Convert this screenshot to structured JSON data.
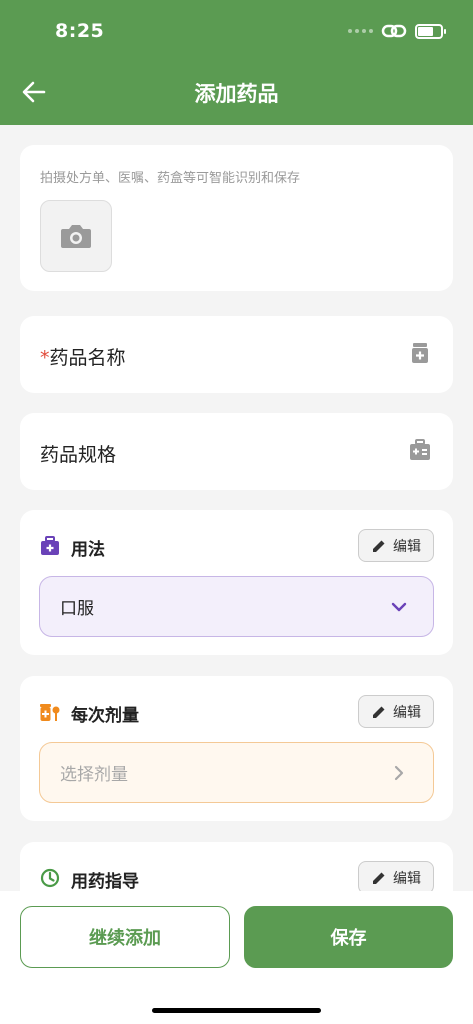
{
  "status_bar": {
    "time": "8:25"
  },
  "header": {
    "title": "添加药品"
  },
  "photo_card": {
    "hint": "拍摄处方单、医嘱、药盒等可智能识别和保存"
  },
  "name_field": {
    "required_mark": "*",
    "label": "药品名称"
  },
  "spec_field": {
    "label": "药品规格"
  },
  "usage": {
    "title": "用法",
    "edit_label": "编辑",
    "value": "口服",
    "accent": "#6a42b8",
    "box_bg": "#f3effb",
    "box_border": "#c7b6e6"
  },
  "dosage": {
    "title": "每次剂量",
    "edit_label": "编辑",
    "placeholder": "选择剂量",
    "accent": "#f08a1c",
    "box_bg": "#fff8ef",
    "box_border": "#f4c996"
  },
  "guide": {
    "title": "用药指导",
    "edit_label": "编辑",
    "accent": "#4a9a47"
  },
  "actions": {
    "continue_label": "继续添加",
    "save_label": "保存"
  },
  "colors": {
    "primary": "#5b9b52"
  },
  "icons": [
    "back-arrow-icon",
    "camera-icon",
    "medicine-bottle-icon",
    "medical-kit-icon",
    "pills-icon",
    "clock-icon",
    "pencil-icon",
    "chevron-down-icon",
    "chevron-right-icon",
    "link-icon",
    "battery-icon"
  ]
}
